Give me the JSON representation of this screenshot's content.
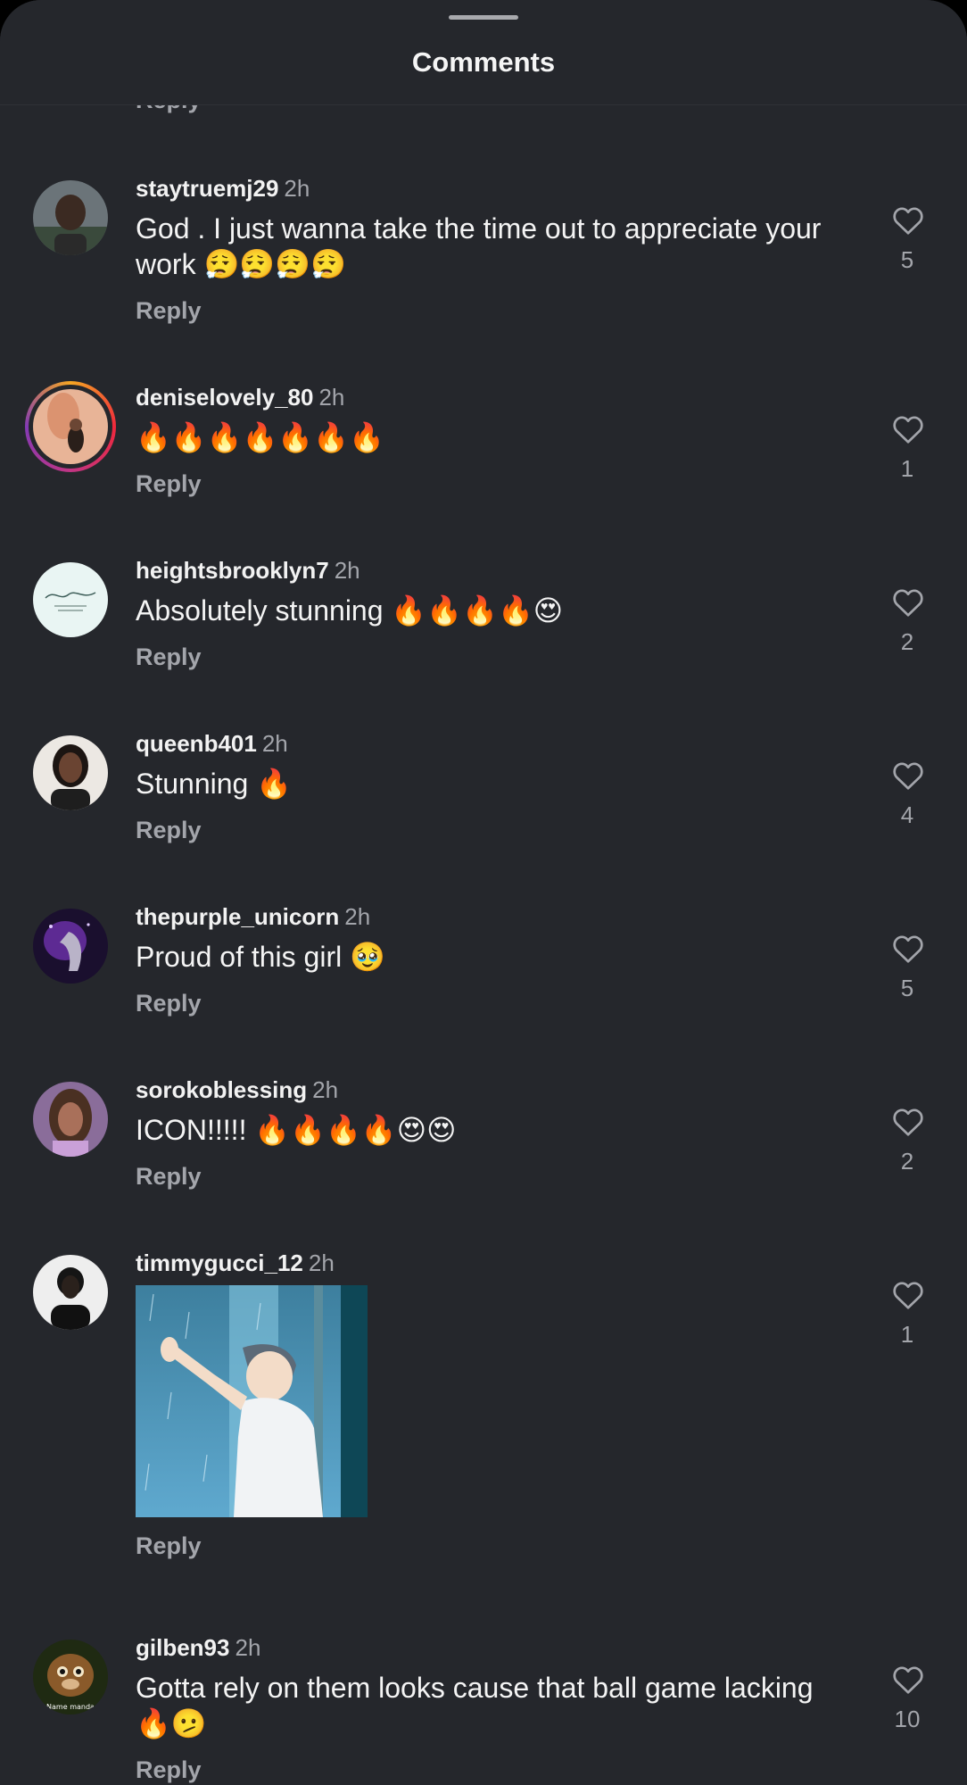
{
  "header": {
    "title": "Comments"
  },
  "top_partial": {
    "reply_label": "Reply"
  },
  "comments": [
    {
      "user": "staytruemj29",
      "time": "2h",
      "text_line1": "God . I just wanna take the time out to appreciate your",
      "text_line2": "work 😮‍💨😮‍💨😮‍💨😮‍💨",
      "likes": "5",
      "reply_label": "Reply"
    },
    {
      "user": "deniselovely_80",
      "time": "2h",
      "text": "🔥🔥🔥🔥🔥🔥🔥",
      "likes": "1",
      "reply_label": "Reply"
    },
    {
      "user": "heightsbrooklyn7",
      "time": "2h",
      "text": "Absolutely stunning 🔥🔥🔥🔥😍",
      "likes": "2",
      "reply_label": "Reply"
    },
    {
      "user": "queenb401",
      "time": "2h",
      "text": "Stunning 🔥",
      "likes": "4",
      "reply_label": "Reply"
    },
    {
      "user": "thepurple_unicorn",
      "time": "2h",
      "text": "Proud of this girl 🥹",
      "likes": "5",
      "reply_label": "Reply"
    },
    {
      "user": "sorokoblessing",
      "time": "2h",
      "text": "ICON!!!!! 🔥🔥🔥🔥😍😍",
      "likes": "2",
      "reply_label": "Reply"
    },
    {
      "user": "timmygucci_12",
      "time": "2h",
      "media": "gif-image",
      "likes": "1",
      "reply_label": "Reply"
    },
    {
      "user": "gilben93",
      "time": "2h",
      "text_line1": "Gotta rely on them looks cause that ball game lacking",
      "text_line2": "🔥🫤",
      "likes": "10",
      "reply_label": "Reply"
    }
  ],
  "avatar_marks": {
    "gilben93": "Name manda"
  },
  "icons": {
    "like": "heart-outline-icon"
  },
  "colors": {
    "background": "#25272c",
    "text": "#f4f4f4",
    "secondary": "#a3a5ab"
  }
}
